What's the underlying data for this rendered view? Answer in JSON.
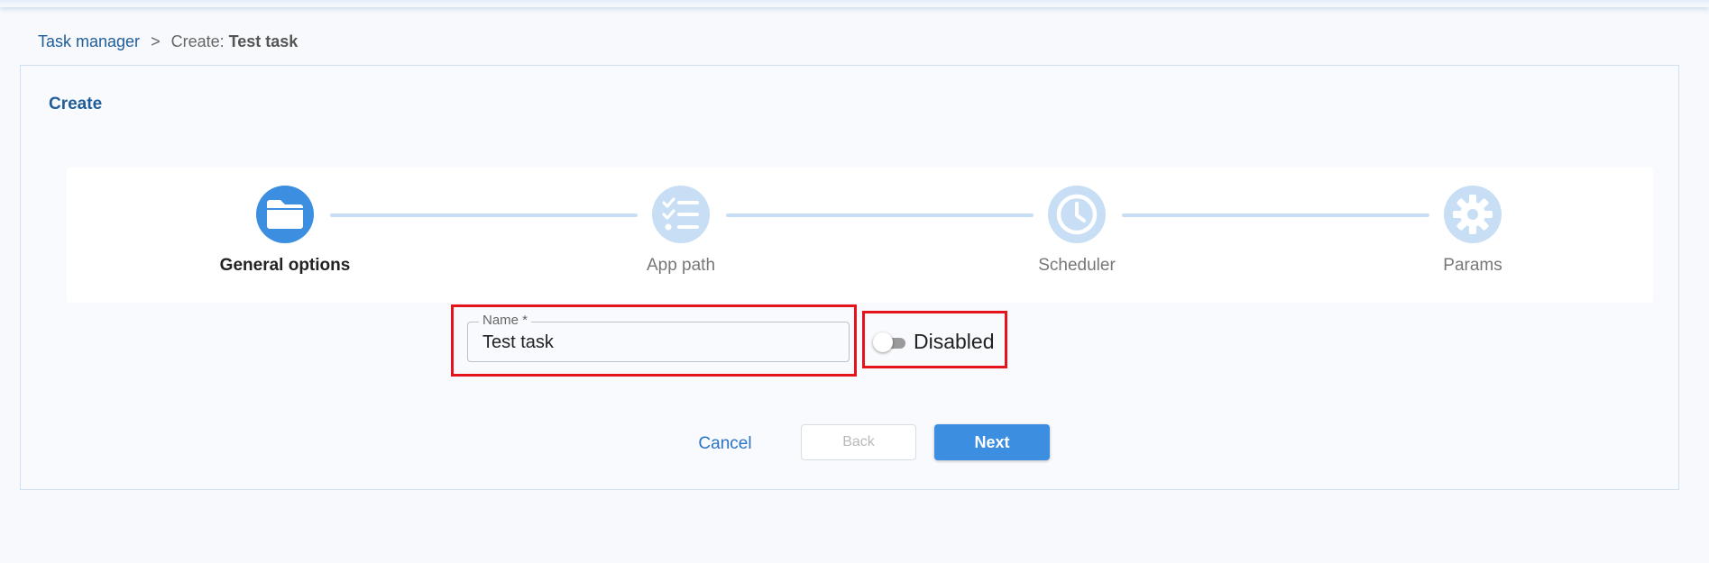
{
  "breadcrumb": {
    "root": "Task manager",
    "separator": ">",
    "current_prefix": "Create:",
    "current_name": "Test task"
  },
  "panel": {
    "title": "Create"
  },
  "stepper": {
    "steps": [
      {
        "label": "General options",
        "icon": "folder-icon",
        "state": "active"
      },
      {
        "label": "App path",
        "icon": "checklist-icon",
        "state": "inactive"
      },
      {
        "label": "Scheduler",
        "icon": "clock-icon",
        "state": "inactive"
      },
      {
        "label": "Params",
        "icon": "gear-icon",
        "state": "inactive"
      }
    ]
  },
  "form": {
    "name_label": "Name *",
    "name_value": "Test task",
    "toggle_label": "Disabled",
    "toggle_on": false
  },
  "actions": {
    "cancel_label": "Cancel",
    "back_label": "Back",
    "next_label": "Next"
  },
  "colors": {
    "accent": "#3b8ee0",
    "link": "#1f5d99",
    "step_inactive": "#c8def5",
    "highlight": "#e3141c"
  }
}
